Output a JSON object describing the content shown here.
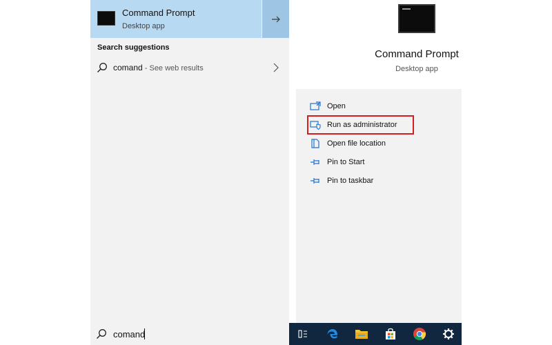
{
  "best_match": {
    "title": "Command Prompt",
    "subtitle": "Desktop app",
    "icon": "command-prompt-icon",
    "open_icon": "arrow-right-icon"
  },
  "suggestions": {
    "heading": "Search suggestions",
    "items": [
      {
        "query": "comand",
        "suffix": " - See web results",
        "icon": "search-icon"
      }
    ]
  },
  "preview": {
    "title": "Command Prompt",
    "subtitle": "Desktop app",
    "actions": [
      {
        "label": "Open",
        "icon": "open-icon"
      },
      {
        "label": "Run as administrator",
        "icon": "run-as-admin-icon",
        "highlighted": true
      },
      {
        "label": "Open file location",
        "icon": "file-location-icon"
      },
      {
        "label": "Pin to Start",
        "icon": "pin-icon"
      },
      {
        "label": "Pin to taskbar",
        "icon": "pin-icon"
      }
    ]
  },
  "search": {
    "value": "comand"
  },
  "taskbar": {
    "items": [
      "task-view-icon",
      "edge-icon",
      "file-explorer-icon",
      "store-icon",
      "chrome-icon",
      "settings-icon"
    ]
  },
  "colors": {
    "selection": "#b8d9f2",
    "selection_button": "#9ec5e3",
    "pane_background": "#f2f2f2",
    "highlight_border": "#d11f1f",
    "taskbar": "#11263f",
    "accent": "#1e73d2"
  }
}
